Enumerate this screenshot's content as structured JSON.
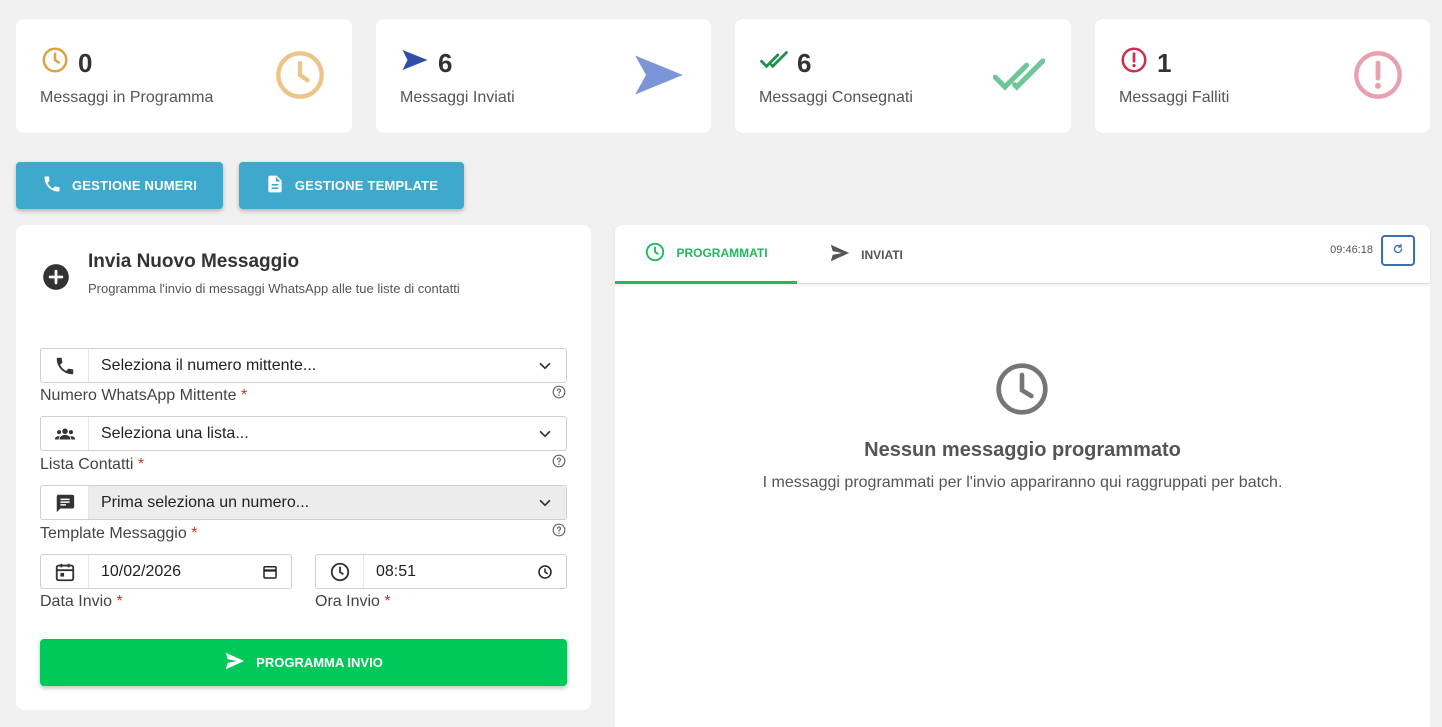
{
  "stats": [
    {
      "count": "0",
      "label": "Messaggi in Programma",
      "icon": "clock-icon",
      "color": "#e6b96a"
    },
    {
      "count": "6",
      "label": "Messaggi Inviati",
      "icon": "send-icon",
      "color": "#3a58b8"
    },
    {
      "count": "6",
      "label": "Messaggi Consegnati",
      "icon": "double-check-icon",
      "color": "#1e9e55"
    },
    {
      "count": "1",
      "label": "Messaggi Falliti",
      "icon": "alert-circle-icon",
      "color": "#c9304b"
    }
  ],
  "actions": {
    "numbers_label": "GESTIONE NUMERI",
    "templates_label": "GESTIONE TEMPLATE"
  },
  "form": {
    "title": "Invia Nuovo Messaggio",
    "subtitle": "Programma l'invio di messaggi WhatsApp alle tue liste di contatti",
    "sender": {
      "value": "Seleziona il numero mittente...",
      "label": "Numero WhatsApp Mittente"
    },
    "list": {
      "value": "Seleziona una lista...",
      "label": "Lista Contatti"
    },
    "template": {
      "value": "Prima seleziona un numero...",
      "label": "Template Messaggio"
    },
    "date": {
      "value": "10/02/2026",
      "label": "Data Invio"
    },
    "time": {
      "value": "08:51",
      "label": "Ora Invio"
    },
    "required_mark": "*",
    "submit_label": "PROGRAMMA INVIO"
  },
  "list_panel": {
    "tabs": [
      {
        "label": "PROGRAMMATI",
        "active": true
      },
      {
        "label": "INVIATI",
        "active": false
      }
    ],
    "time": "09:46:18",
    "empty_title": "Nessun messaggio programmato",
    "empty_text": "I messaggi programmati per l'invio appariranno qui raggruppati per batch."
  },
  "colors": {
    "accent_blue": "#3ea9cc",
    "accent_green": "#00c95a",
    "tab_green": "#1fb85c"
  }
}
